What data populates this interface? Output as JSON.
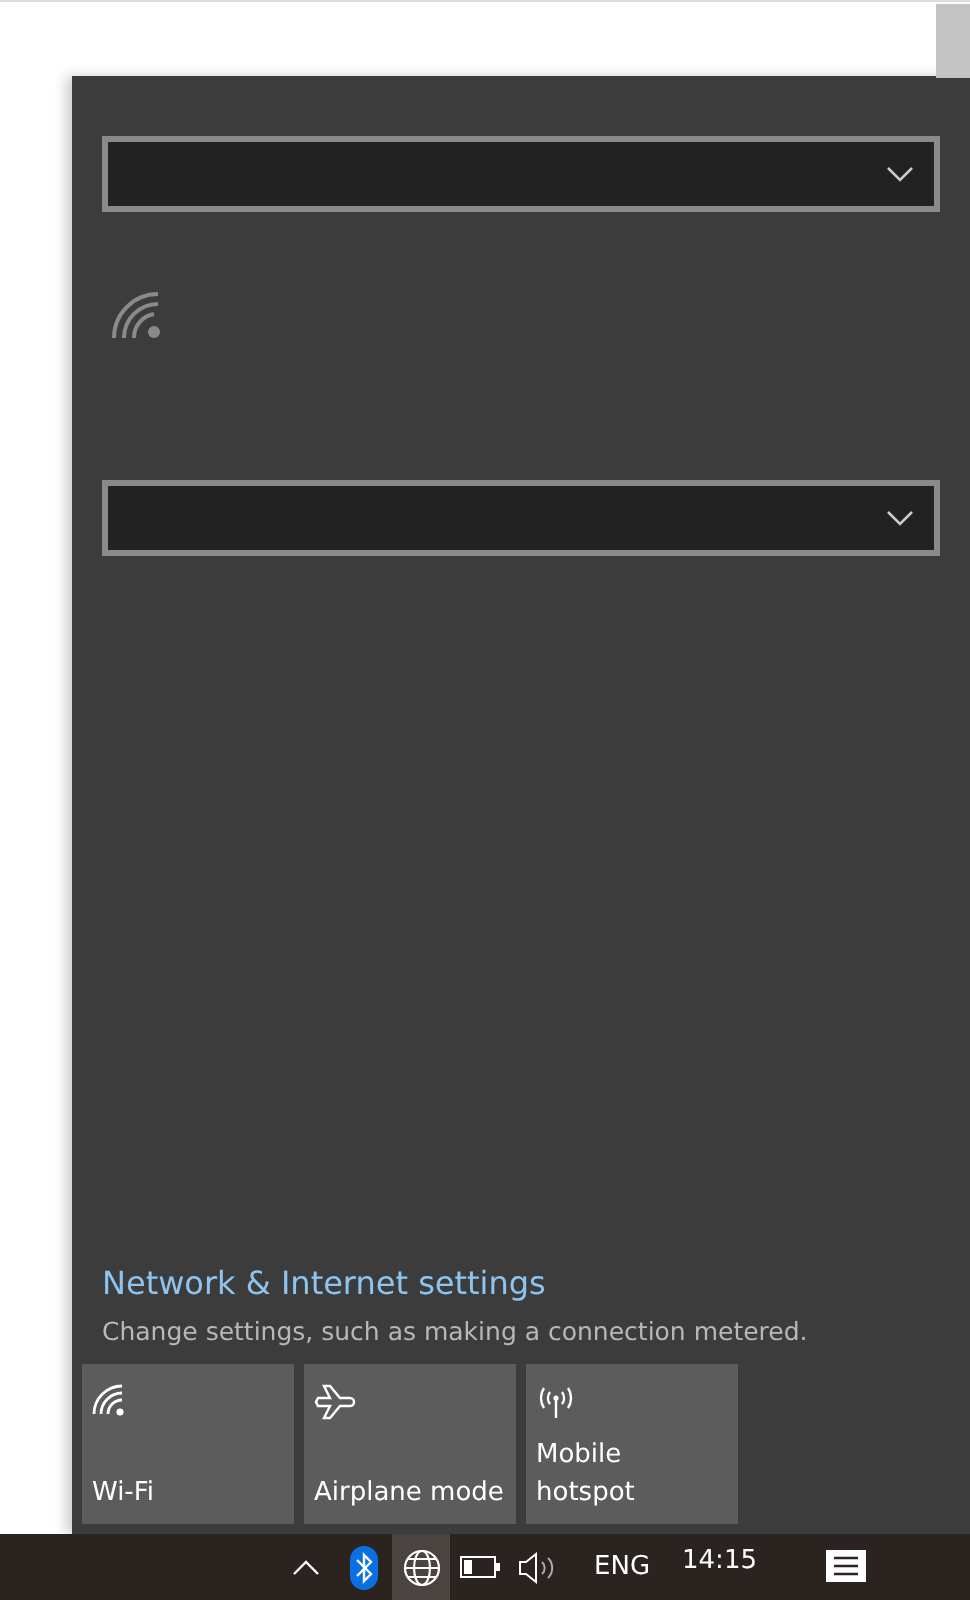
{
  "dropdowns": [
    {
      "kind": "dropdown"
    },
    {
      "kind": "dropdown"
    }
  ],
  "settings_link": {
    "label": "Network & Internet settings",
    "description": "Change settings, such as making a connection metered."
  },
  "quick_actions": [
    {
      "kind": "wifi",
      "label": "Wi-Fi",
      "on": false
    },
    {
      "kind": "airplane",
      "label": "Airplane mode",
      "on": false
    },
    {
      "kind": "hotspot",
      "label": "Mobile hotspot",
      "on": false
    }
  ],
  "taskbar": {
    "tray_icons": [
      {
        "kind": "chevron",
        "selected": false
      },
      {
        "kind": "bluetooth",
        "selected": false
      },
      {
        "kind": "network",
        "selected": true
      },
      {
        "kind": "battery",
        "selected": false
      },
      {
        "kind": "volume",
        "selected": false
      }
    ],
    "language": "ENG",
    "time": "14:15"
  }
}
